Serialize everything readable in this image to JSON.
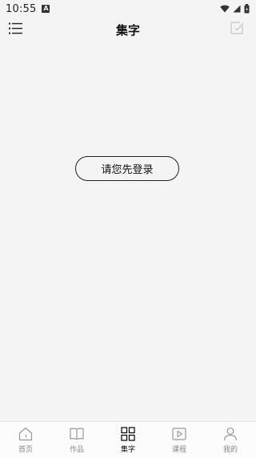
{
  "status_bar": {
    "time": "10:55",
    "notification_glyph": "A",
    "icons": [
      "wifi-icon",
      "signal-icon",
      "battery-icon"
    ]
  },
  "header": {
    "title": "集字",
    "left_icon": "menu-list-icon",
    "right_icon": "edit-icon"
  },
  "main": {
    "login_label": "请您先登录"
  },
  "bottom_nav": {
    "items": [
      {
        "label": "首页",
        "icon": "home-icon",
        "active": false
      },
      {
        "label": "作品",
        "icon": "book-icon",
        "active": false
      },
      {
        "label": "集字",
        "icon": "grid-icon",
        "active": true
      },
      {
        "label": "课程",
        "icon": "play-icon",
        "active": false
      },
      {
        "label": "我的",
        "icon": "user-icon",
        "active": false
      }
    ]
  },
  "colors": {
    "background": "#f4f4f4",
    "nav_background": "#fcfcfc",
    "active_text": "#111111",
    "inactive_text": "#888888"
  }
}
